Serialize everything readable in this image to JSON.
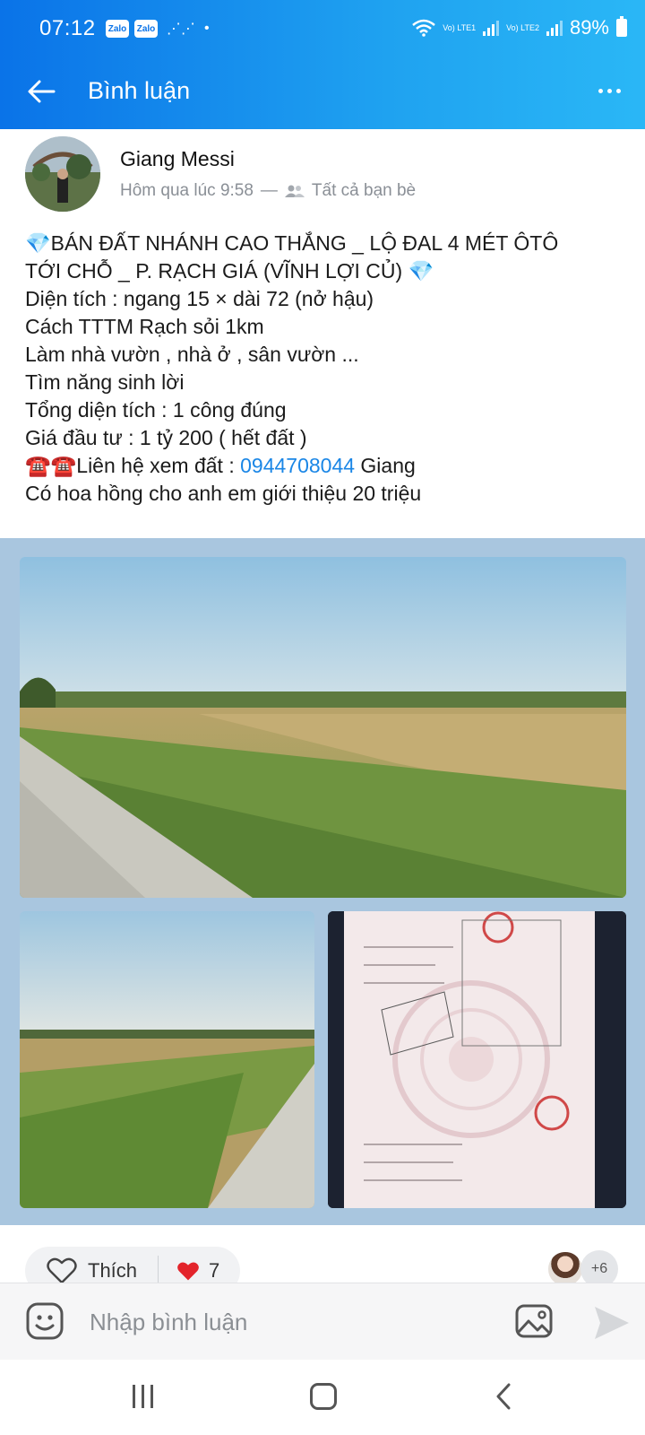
{
  "status_bar": {
    "time": "07:12",
    "left_icons": [
      "zalo-icon",
      "zalo-icon",
      "voicemail-icon",
      "dot-icon"
    ],
    "zalo_label": "Zalo",
    "network_1": "Vo) LTE1",
    "network_2": "Vo) LTE2",
    "battery": "89%"
  },
  "header": {
    "title": "Bình luận",
    "back_icon": "arrow-left-icon",
    "more_icon": "more-horizontal-icon"
  },
  "post": {
    "author": "Giang Messi",
    "timestamp": "Hôm qua lúc 9:58",
    "separator": "—",
    "privacy": "Tất cả bạn bè",
    "lines": [
      "💎BÁN ĐẤT NHÁNH CAO THẮNG _ LỘ ĐAL 4 MÉT ÔTÔ",
      "TỚI CHỖ _ P. RẠCH GIÁ (VĨNH LỢI CỦ) 💎",
      "Diện tích : ngang 15 × dài 72 (nở hậu)",
      "Cách TTTM Rạch sỏi 1km",
      "Làm nhà vườn , nhà ở , sân vườn ...",
      "Tìm năng sinh lời",
      "Tổng diện tích : 1 công đúng",
      "Giá đầu tư : 1 tỷ 200 ( hết đất )"
    ],
    "contact_prefix": "☎️☎️Liên hệ xem đất : ",
    "contact_phone": "0944708044",
    "contact_suffix": " Giang",
    "last_line": "Có hoa hồng cho anh em giới thiệu 20 triệu"
  },
  "reactions": {
    "like_label": "Thích",
    "heart_count": "7",
    "more_reactors": "+6"
  },
  "comment_bar": {
    "placeholder": "Nhập bình luận"
  },
  "colors": {
    "header_gradient_start": "#0a73e8",
    "header_gradient_end": "#2ab7f6",
    "link": "#1a86e6",
    "photos_background": "#a9c6df"
  }
}
